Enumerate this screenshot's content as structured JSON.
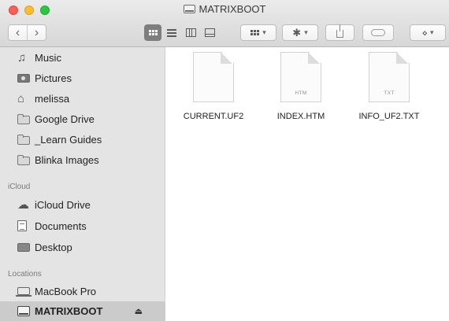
{
  "window": {
    "title": "MATRIXBOOT"
  },
  "toolbar": {
    "back_glyph": "‹",
    "forward_glyph": "›",
    "active_view": "icon-view",
    "view_buttons": [
      "icon-view",
      "list-view",
      "column-view",
      "gallery-view"
    ],
    "arrange_glyph": "▾",
    "action_glyph": "✱",
    "action_chevron": "▾",
    "arrange_chevron": "▾",
    "dropbox_glyph": "⋄",
    "dropbox_chevron": "▾"
  },
  "sidebar": {
    "favorites": [
      {
        "label": "Music",
        "icon": "music-icon"
      },
      {
        "label": "Pictures",
        "icon": "camera-icon"
      },
      {
        "label": "melissa",
        "icon": "home-icon"
      },
      {
        "label": "Google Drive",
        "icon": "folder-icon"
      },
      {
        "label": "_Learn Guides",
        "icon": "folder-icon"
      },
      {
        "label": "Blinka Images",
        "icon": "folder-icon"
      }
    ],
    "icloud_header": "iCloud",
    "icloud": [
      {
        "label": "iCloud Drive",
        "icon": "cloud-icon"
      },
      {
        "label": "Documents",
        "icon": "documents-icon"
      },
      {
        "label": "Desktop",
        "icon": "desktop-icon"
      }
    ],
    "locations_header": "Locations",
    "locations": [
      {
        "label": "MacBook Pro",
        "icon": "laptop-icon"
      },
      {
        "label": "MATRIXBOOT",
        "icon": "drive-icon",
        "selected": true,
        "eject": "⏏"
      }
    ]
  },
  "files": [
    {
      "name": "CURRENT.UF2",
      "ext_label": ""
    },
    {
      "name": "INDEX.HTM",
      "ext_label": "HTM"
    },
    {
      "name": "INFO_UF2.TXT",
      "ext_label": "TXT"
    }
  ],
  "colors": {
    "sidebar_bg": "#e4e4e4",
    "selected_bg": "#cbcbcb",
    "close": "#fd5f57",
    "minimize": "#febc2e",
    "zoom": "#2ac840"
  }
}
